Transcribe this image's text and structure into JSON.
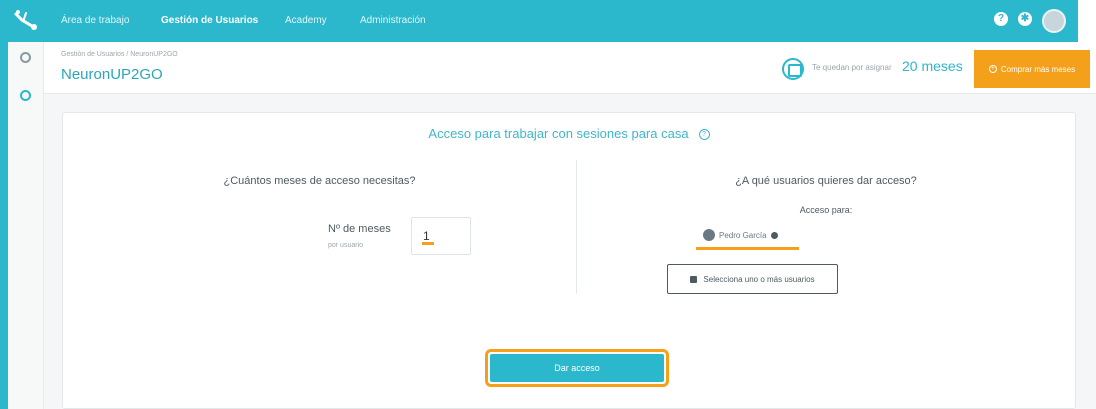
{
  "nav": {
    "items": [
      {
        "label": "Área de trabajo",
        "active": false
      },
      {
        "label": "Gestión de Usuarios",
        "active": true
      },
      {
        "label": "Academy",
        "active": false
      },
      {
        "label": "Administración",
        "active": false
      }
    ],
    "icons": [
      "help-icon",
      "gear-icon",
      "user-avatar"
    ]
  },
  "header": {
    "breadcrumb": "Gestión de Usuarios  /  NeuronUP2GO",
    "title": "NeuronUP2GO",
    "remaining_text": "Te quedan por asignar",
    "remaining_value": "20 meses",
    "buy_button": "Comprar más meses"
  },
  "card": {
    "title": "Acceso para trabajar con sesiones para casa",
    "left_question": "¿Cuántos meses de acceso necesitas?",
    "months_label": "Nº de meses",
    "months_sub": "por usuario",
    "months_value": "1",
    "right_question": "¿A qué usuarios quieres dar acceso?",
    "access_for": "Acceso para:",
    "selected_user": "Pedro García",
    "select_users_button": "Selecciona uno o más usuarios",
    "give_access_button": "Dar acceso"
  },
  "colors": {
    "brand": "#2bb8cc",
    "accent": "#f5a01a"
  }
}
